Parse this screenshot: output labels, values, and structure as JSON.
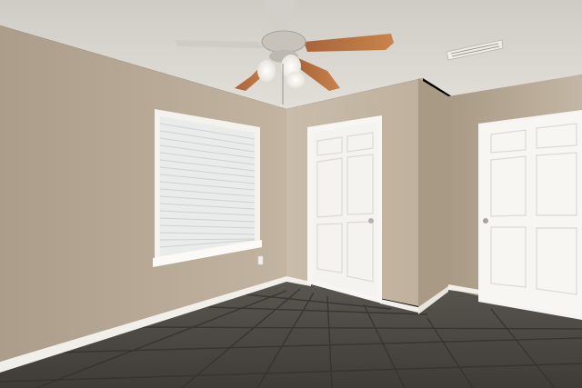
{
  "scene": {
    "type": "photo",
    "subject": "empty-bedroom-interior",
    "palette": {
      "ceiling": "#d9d6d0",
      "wall_left": "#bcae9c",
      "wall_back": "#c7b9a6",
      "wall_right": "#b7a892",
      "trim": "#f4f2ee",
      "door": "#f6f5f2",
      "floor": "#4a4743",
      "floor_grout": "#3a3835",
      "fan_wood": "#b8743f",
      "fan_metal": "#c9c4bc",
      "window_glass": "#eef0f0"
    },
    "icons": [
      "ceiling-fan-icon",
      "air-vent-icon",
      "window-blinds-icon",
      "door-icon",
      "power-outlet-icon"
    ]
  }
}
